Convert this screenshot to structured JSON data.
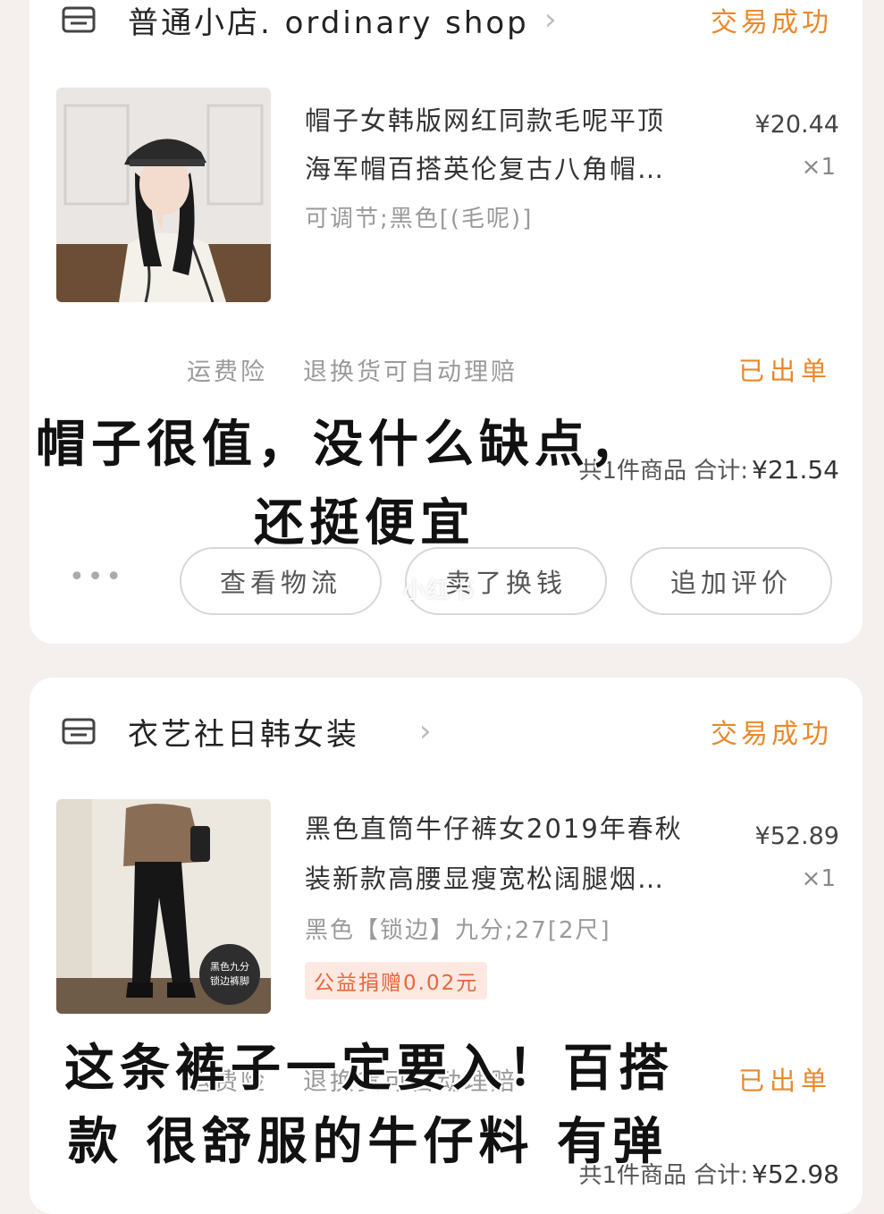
{
  "order1": {
    "shop_name": "普通小店. ordinary shop",
    "status": "交易成功",
    "title_line1": "帽子女韩版网红同款毛呢平顶",
    "title_line2": "海军帽百搭英伦复古八角帽…",
    "sku": "可调节;黑色[(毛呢)]",
    "price": "¥20.44",
    "qty": "×1",
    "service1": "运费险",
    "service2": "退换货可自动理赔",
    "shipping_status": "已出单",
    "total_label": "共1件商品 合计:",
    "total_amount": "¥21.54",
    "buttons": [
      "查看物流",
      "卖了换钱",
      "追加评价"
    ]
  },
  "order2": {
    "shop_name": "衣艺社日韩女装",
    "status": "交易成功",
    "title_line1": "黑色直筒牛仔裤女2019年春秋",
    "title_line2": "装新款高腰显瘦宽松阔腿烟…",
    "sku": "黑色【锁边】九分;27[2尺]",
    "price": "¥52.89",
    "qty": "×1",
    "donation": "公益捐赠0.02元",
    "thumb_badge_line1": "黑色九分",
    "thumb_badge_line2": "锁边裤脚",
    "service1": "运费险",
    "service2": "退换货可自动理赔",
    "shipping_status": "已出单",
    "total_label": "共1件商品 合计:",
    "total_amount": "¥52.98"
  },
  "overlay": {
    "caption1_line1": "帽子很值，没什么缺点，",
    "caption1_line2": "还挺便宜",
    "caption2_line1": "这条裤子一定要入！百搭",
    "caption2_line2": "款 很舒服的牛仔料 有弹"
  },
  "watermark": "小红书",
  "colors": {
    "status_orange": "#e8892b",
    "donation_red": "#e8663b",
    "background": "#f5f0ee"
  }
}
